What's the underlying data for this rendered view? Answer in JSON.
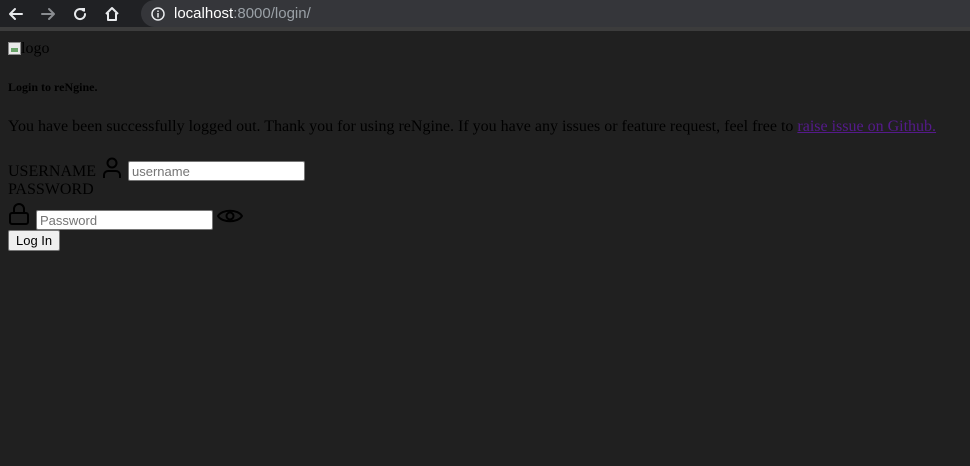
{
  "browser": {
    "url_host": "localhost",
    "url_rest": ":8000/login/",
    "icons": [
      "back-icon",
      "forward-icon",
      "reload-icon",
      "home-icon",
      "info-icon"
    ]
  },
  "page": {
    "logo_alt": "logo",
    "heading": "Login to reNgine.",
    "message": "You have been successfully logged out. Thank you for using reNgine. If you have any issues or feature request, feel free to ",
    "message_link": "raise issue on Github.",
    "username_label": "USERNAME",
    "username_placeholder": "username",
    "password_label": "PASSWORD",
    "password_placeholder": "Password",
    "login_button": "Log In",
    "link_color": "#551a8b",
    "background_color": "#202020"
  }
}
